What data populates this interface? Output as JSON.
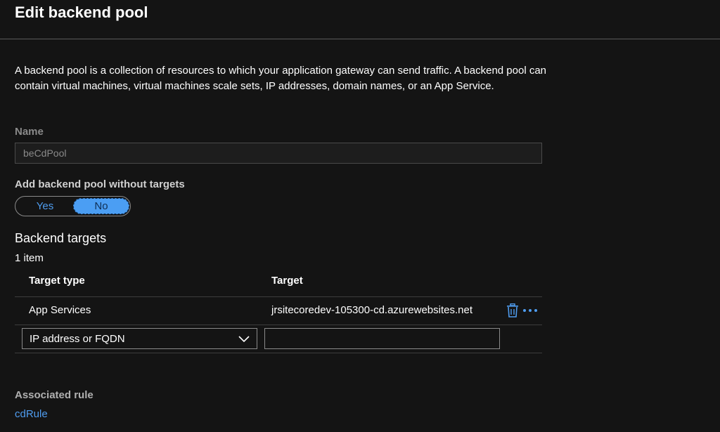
{
  "header": {
    "title": "Edit backend pool"
  },
  "description": "A backend pool is a collection of resources to which your application gateway can send traffic. A backend pool can contain virtual machines, virtual machines scale sets, IP addresses, domain names, or an App Service.",
  "name_field": {
    "label": "Name",
    "value": "beCdPool"
  },
  "without_targets": {
    "label": "Add backend pool without targets",
    "options": [
      "Yes",
      "No"
    ],
    "selected": "No"
  },
  "backend_targets": {
    "heading": "Backend targets",
    "count": "1 item",
    "columns": [
      "Target type",
      "Target"
    ],
    "rows": [
      {
        "type": "App Services",
        "target": "jrsitecoredev-105300-cd.azurewebsites.net"
      }
    ],
    "new_row": {
      "type_selected": "IP address or FQDN",
      "target_value": ""
    },
    "row_icons": [
      "trash-icon",
      "more-icon"
    ]
  },
  "associated_rule": {
    "label": "Associated rule",
    "link": "cdRule"
  },
  "colors": {
    "background": "#141414",
    "accent": "#4f9df0",
    "toggle_selected": "#4b9ef3"
  }
}
